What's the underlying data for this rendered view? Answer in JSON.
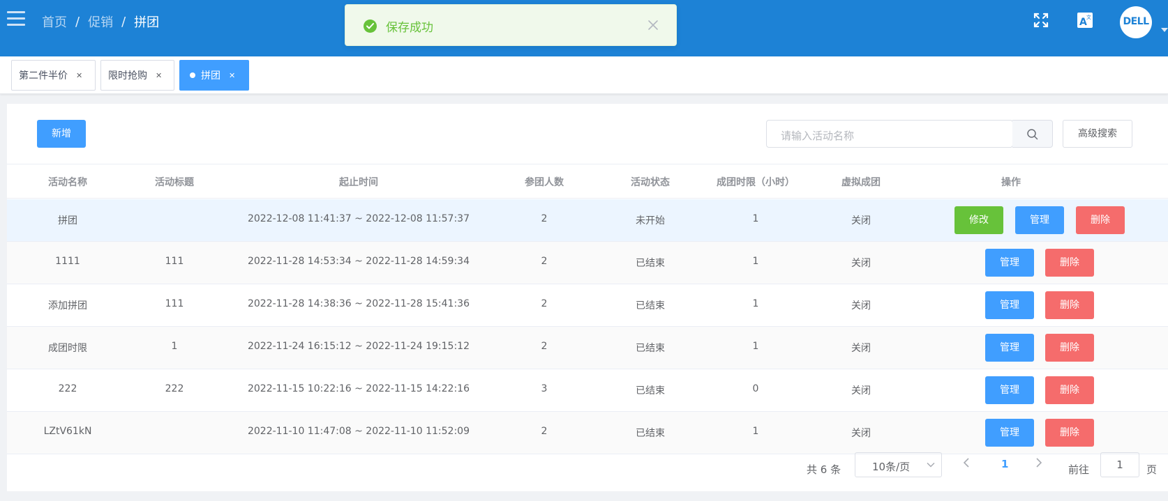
{
  "breadcrumb": [
    "首页",
    "促销",
    "拼团"
  ],
  "toast": {
    "message": "保存成功"
  },
  "colors": {
    "header": "#1d82d6",
    "primary": "#409eff",
    "success": "#67c23a",
    "danger": "#f56c6c"
  },
  "header_icons": [
    "fullscreen-icon",
    "translate-icon"
  ],
  "avatar": {
    "text": "DELL"
  },
  "tags": [
    {
      "label": "第二件半价"
    },
    {
      "label": "限时抢购"
    },
    {
      "label": "拼团",
      "active": true
    }
  ],
  "toolbar": {
    "add_label": "新增",
    "search_placeholder": "请输入活动名称",
    "advanced_label": "高级搜索"
  },
  "table": {
    "columns": [
      "活动名称",
      "活动标题",
      "起止时间",
      "参团人数",
      "活动状态",
      "成团时限（小时）",
      "虚拟成团",
      "操作"
    ],
    "rows": [
      {
        "name": "拼团",
        "title": "",
        "period": "2022-12-08 11:41:37 ~ 2022-12-08 11:57:37",
        "members": "2",
        "status": "未开始",
        "limit": "1",
        "virtual": "关闭",
        "actions": [
          "修改",
          "管理",
          "删除"
        ]
      },
      {
        "name": "1111",
        "title": "111",
        "period": "2022-11-28 14:53:34 ~ 2022-11-28 14:59:34",
        "members": "2",
        "status": "已结束",
        "limit": "1",
        "virtual": "关闭",
        "actions": [
          "管理",
          "删除"
        ]
      },
      {
        "name": "添加拼团",
        "title": "111",
        "period": "2022-11-28 14:38:36 ~ 2022-11-28 15:41:36",
        "members": "2",
        "status": "已结束",
        "limit": "1",
        "virtual": "关闭",
        "actions": [
          "管理",
          "删除"
        ]
      },
      {
        "name": "成团时限",
        "title": "1",
        "period": "2022-11-24 16:15:12 ~ 2022-11-24 19:15:12",
        "members": "2",
        "status": "已结束",
        "limit": "1",
        "virtual": "关闭",
        "actions": [
          "管理",
          "删除"
        ]
      },
      {
        "name": "222",
        "title": "222",
        "period": "2022-11-15 10:22:16 ~ 2022-11-15 14:22:16",
        "members": "3",
        "status": "已结束",
        "limit": "0",
        "virtual": "关闭",
        "actions": [
          "管理",
          "删除"
        ]
      },
      {
        "name": "LZtV61kN",
        "title": "",
        "period": "2022-11-10 11:47:08 ~ 2022-11-10 11:52:09",
        "members": "2",
        "status": "已结束",
        "limit": "1",
        "virtual": "关闭",
        "actions": [
          "管理",
          "删除"
        ]
      }
    ]
  },
  "pagination": {
    "total": "共 6 条",
    "page_size": "10条/页",
    "current": "1",
    "goto_prefix": "前往",
    "goto_value": "1",
    "goto_suffix": "页"
  }
}
